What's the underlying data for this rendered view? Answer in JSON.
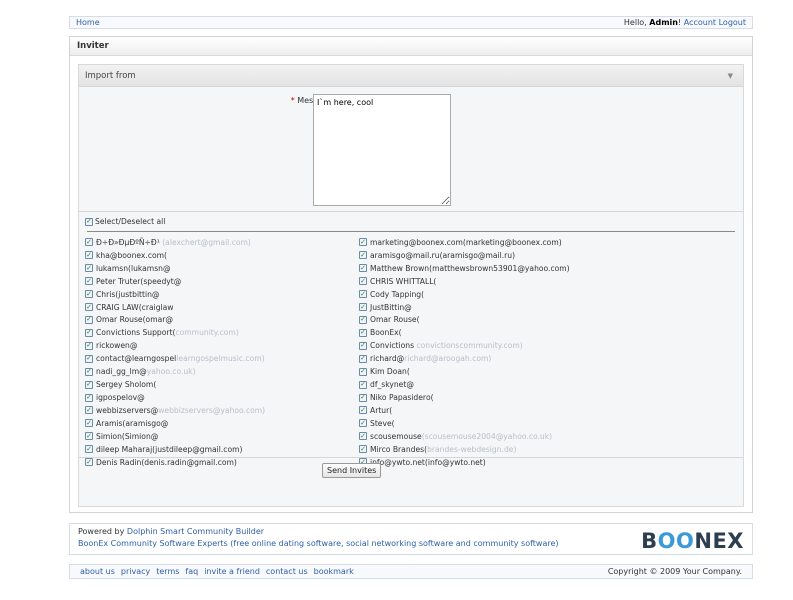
{
  "topbar": {
    "home": "Home",
    "hello": "Hello, ",
    "user": "Admin",
    "excl": "!",
    "account": "Account",
    "logout": "Logout"
  },
  "panel": {
    "title": "Inviter"
  },
  "import": {
    "title": "Import from",
    "message_label": "Message:",
    "required_mark": "*",
    "message_value": "I`m here, cool",
    "select_all": "Select/Deselect all",
    "send_button": "Send Invites"
  },
  "contacts_left": [
    "Ð÷Ð»ÐµÐºÑ÷Ð¹ ",
    "kha@boonex.com(",
    "lukamsn(lukamsn@",
    "Peter Truter(speedyt@",
    "Chris(justbittin@",
    "CRAIG LAW(craiglaw",
    "Omar Rouse(omar@",
    "Convictions Support(",
    "rickowen@",
    "contact@learngospel",
    "nadi_gg_lm@",
    "Sergey Sholom(",
    "igpospelov@",
    "webbizservers@",
    "Aramis(aramisgo@",
    "Simion(Simion@",
    "dileep Maharaj(justdileep@gmail.com)",
    "Denis Radin(denis.radin@gmail.com)"
  ],
  "contacts_left_tail": [
    "(alexchert@gmail.com)",
    "",
    "",
    "",
    "",
    "",
    "",
    "community.com)",
    "",
    "learngospelmusic.com)",
    "yahoo.co.uk)",
    "",
    "",
    "webbizservers@yahoo.com)",
    "",
    "",
    "",
    ""
  ],
  "contacts_right": [
    "marketing@boonex.com(marketing@boonex.com)",
    "aramisgo@mail.ru(aramisgo@mail.ru)",
    "Matthew Brown(matthewsbrown53901@yahoo.com)",
    "CHRIS WHITTALL(",
    "Cody Tapping(",
    "JustBittin@",
    "Omar Rouse(",
    "BoonEx(",
    "Convictions ",
    "richard@",
    "Kim Doan(",
    "df_skynet@",
    "Niko Papasiderо(",
    "Artur(",
    "Steve(",
    "scousemouse",
    "Mirco Brandes(",
    "info@ywto.net(info@ywto.net)"
  ],
  "contacts_right_tail": [
    "",
    "",
    "",
    "",
    "",
    "",
    "",
    "",
    "convictionscommunity.com)",
    "richard@aroogah.com)",
    "",
    "",
    "",
    "",
    "",
    "(scousemouse2004@yahoo.co.uk)",
    "brandes-webdesign.de)",
    ""
  ],
  "footer": {
    "powered_by": "Powered by",
    "dolphin": "Dolphin Smart Community Builder",
    "boonex_experts": "BoonEx Community Software Experts",
    "experts_desc": " (free online dating software, social networking software and community software)",
    "logo_b": "B",
    "logo_oo": "OO",
    "logo_rest": "NEX",
    "links": [
      "about us",
      "privacy",
      "terms",
      "faq",
      "invite a friend",
      "contact us",
      "bookmark"
    ],
    "copyright": "Copyright © 2009 Your Company."
  },
  "colors": {
    "link": "#2f5fa7",
    "required": "#cc0000",
    "logo_dark": "#2d3e50",
    "logo_accent": "#3a9ad9"
  }
}
